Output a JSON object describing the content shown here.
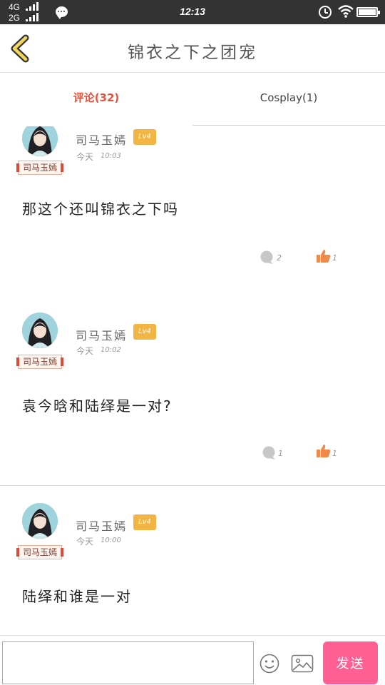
{
  "status_bar": {
    "network_top": "4G",
    "network_bottom": "2G",
    "time": "12:13",
    "icons": [
      "signal-icon",
      "chat-notification-icon",
      "alarm-icon",
      "wifi-icon",
      "battery-icon"
    ]
  },
  "header": {
    "back_icon": "back-chevron-icon",
    "title": "锦衣之下之团宠"
  },
  "tabs": [
    {
      "label": "评论(32)",
      "active": true
    },
    {
      "label": "Cosplay(1)",
      "active": false
    }
  ],
  "comments": [
    {
      "username": "司马玉嫣",
      "level": "Lv4",
      "badge": "司马玉嫣",
      "day": "今天",
      "time": "10:03",
      "text": "那这个还叫锦衣之下吗",
      "replies": "2",
      "likes": "1"
    },
    {
      "username": "司马玉嫣",
      "level": "Lv4",
      "badge": "司马玉嫣",
      "day": "今天",
      "time": "10:02",
      "text": "袁今晗和陆绎是一对?",
      "replies": "1",
      "likes": "1"
    },
    {
      "username": "司马玉嫣",
      "level": "Lv4",
      "badge": "司马玉嫣",
      "day": "今天",
      "time": "10:00",
      "text": "陆绎和谁是一对",
      "replies": "",
      "likes": ""
    }
  ],
  "bottom_bar": {
    "input_value": "",
    "input_placeholder": "",
    "emoji_icon": "emoji-icon",
    "image_icon": "image-icon",
    "send_label": "发送"
  },
  "colors": {
    "active_tab": "#e8503a",
    "level_badge": "#f2b544",
    "like_icon": "#f08a4b",
    "send_button": "#ff5f93",
    "status_bar": "#333333"
  }
}
